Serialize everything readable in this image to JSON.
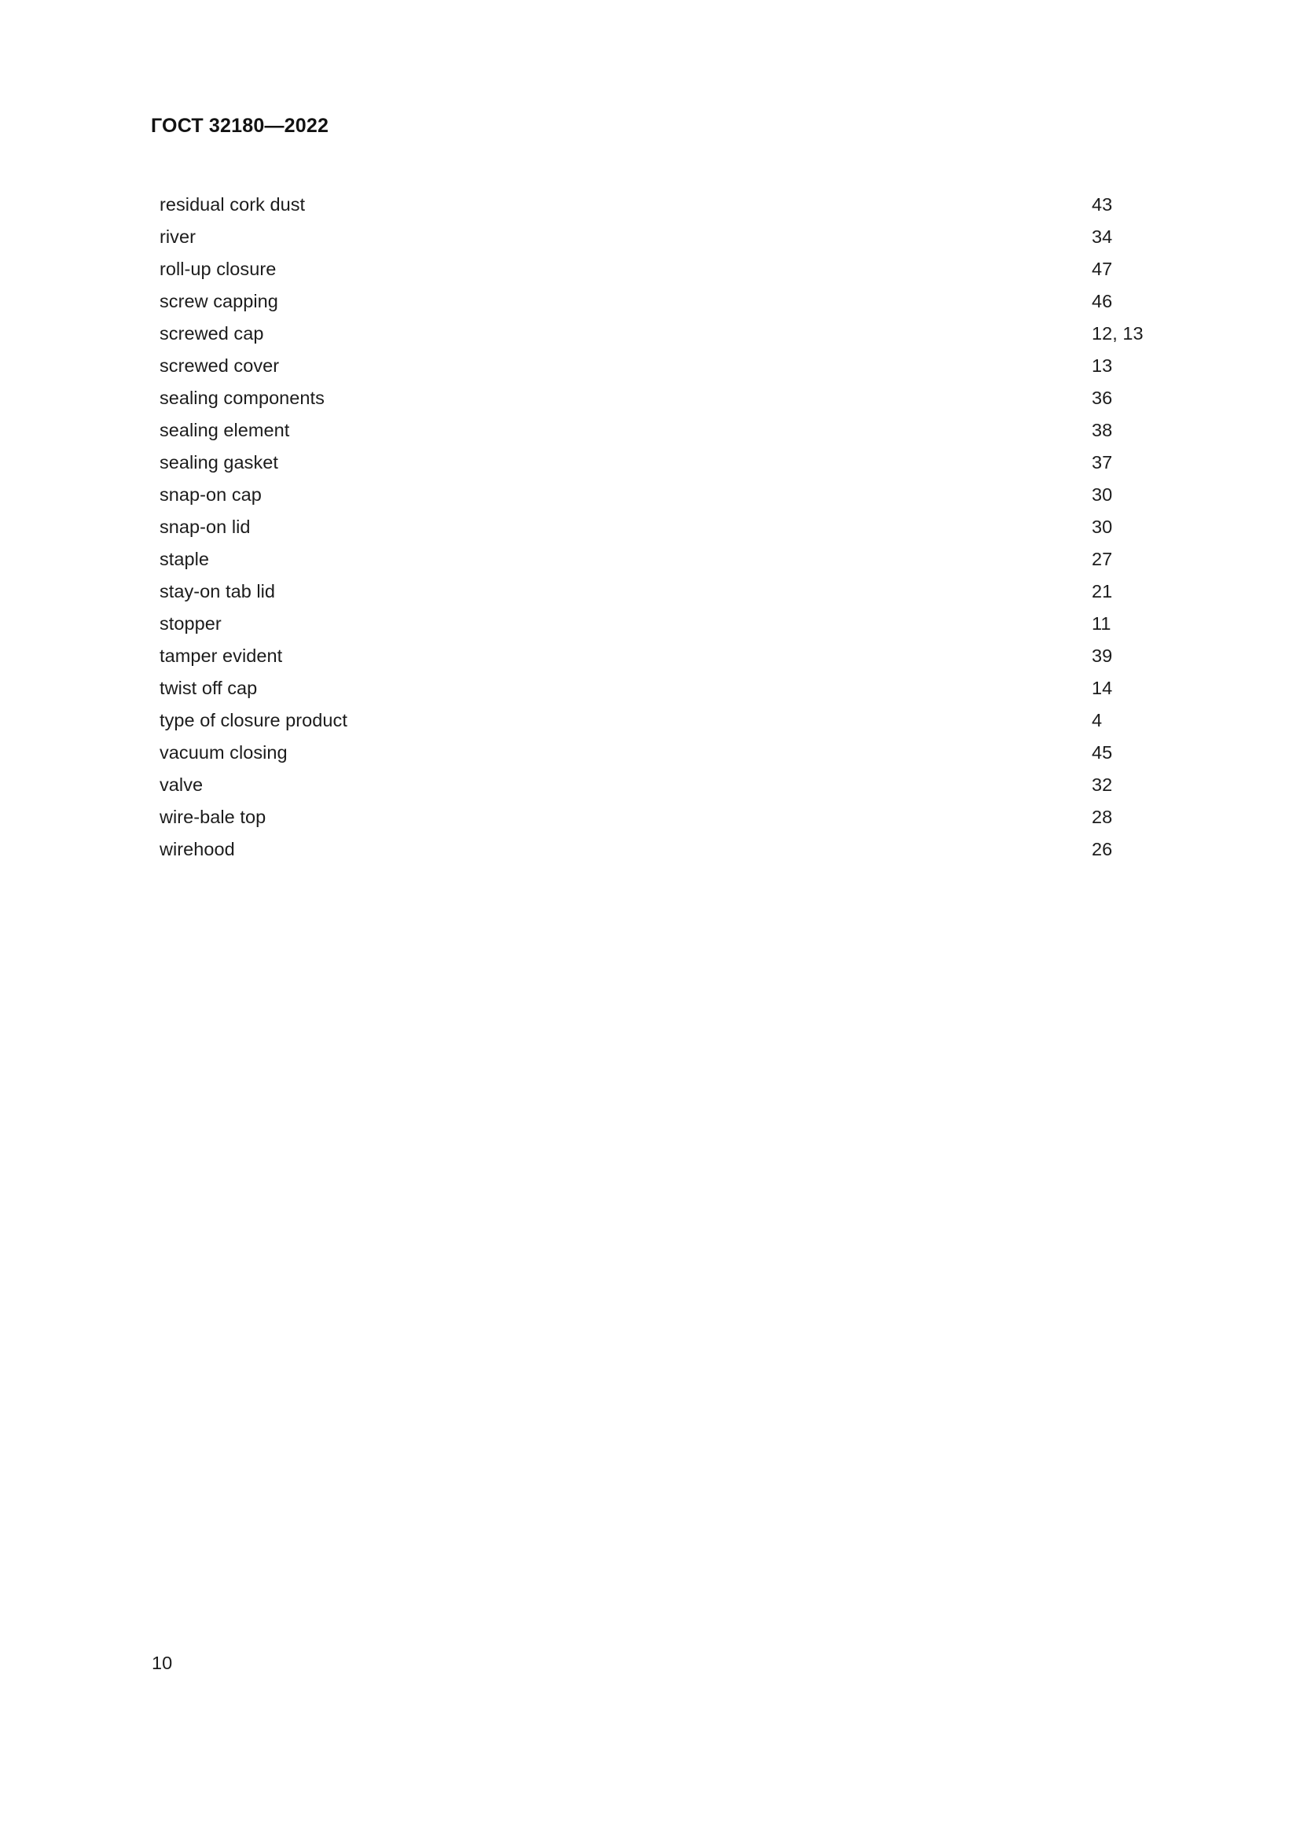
{
  "document": {
    "running_head": "ГОСТ 32180—2022",
    "folio": "10"
  },
  "index": {
    "entries": [
      {
        "term": "residual cork dust",
        "pages": "43"
      },
      {
        "term": "river",
        "pages": "34"
      },
      {
        "term": "roll-up closure",
        "pages": "47"
      },
      {
        "term": "screw capping",
        "pages": "46"
      },
      {
        "term": "screwed cap",
        "pages": "12, 13"
      },
      {
        "term": "screwed cover",
        "pages": "13"
      },
      {
        "term": "sealing components",
        "pages": "36"
      },
      {
        "term": "sealing element",
        "pages": "38"
      },
      {
        "term": "sealing gasket",
        "pages": "37"
      },
      {
        "term": "snap-on cap",
        "pages": "30"
      },
      {
        "term": "snap-on lid",
        "pages": "30"
      },
      {
        "term": "staple",
        "pages": "27"
      },
      {
        "term": "stay-on tab lid",
        "pages": "21"
      },
      {
        "term": "stopper",
        "pages": "11"
      },
      {
        "term": "tamper evident",
        "pages": "39"
      },
      {
        "term": "twist off cap",
        "pages": "14"
      },
      {
        "term": "type of closure product",
        "pages": "4"
      },
      {
        "term": "vacuum closing",
        "pages": "45"
      },
      {
        "term": "valve",
        "pages": "32"
      },
      {
        "term": "wire-bale top",
        "pages": "28"
      },
      {
        "term": "wirehood",
        "pages": "26"
      }
    ]
  }
}
